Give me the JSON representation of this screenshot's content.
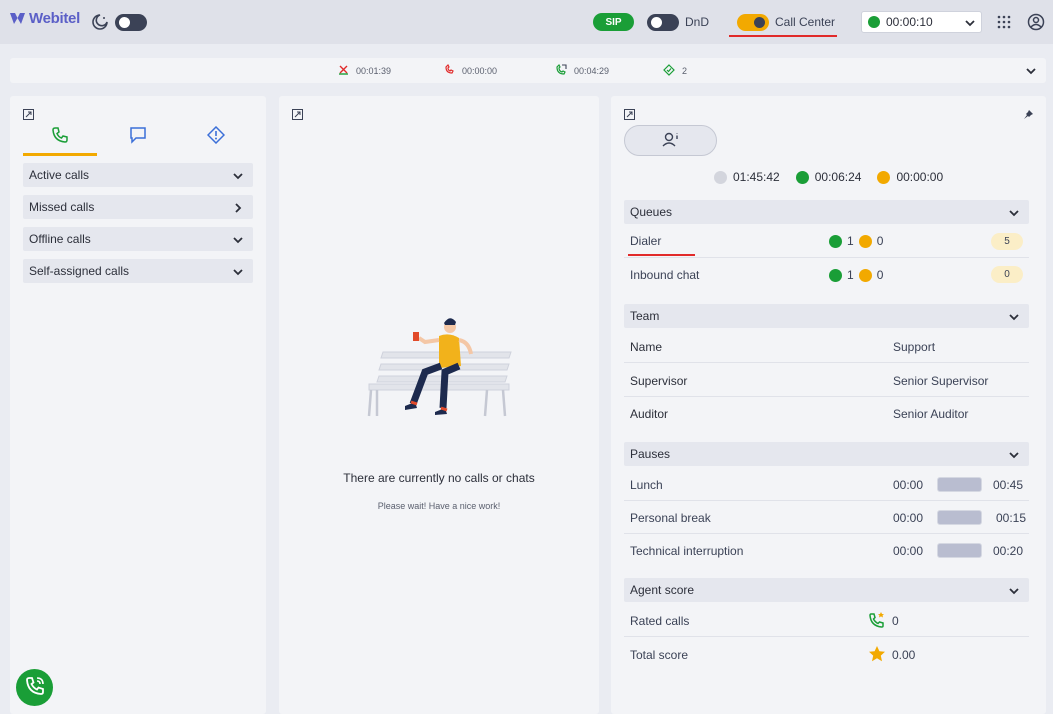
{
  "app": {
    "name": "Webitel"
  },
  "topbar": {
    "sip_label": "SIP",
    "dnd_label": "DnD",
    "call_center_label": "Call Center",
    "status_time": "00:00:10",
    "status_color": "#1a9e37",
    "accent": "#f2a900"
  },
  "stats": [
    {
      "icon": "missed-call-icon",
      "value": "00:01:39"
    },
    {
      "icon": "ended-call-icon",
      "value": "00:00:00"
    },
    {
      "icon": "transfer-call-icon",
      "value": "00:04:29"
    },
    {
      "icon": "diamond-check-icon",
      "value": "2"
    }
  ],
  "left": {
    "tabs": [
      {
        "icon": "phone-icon",
        "active": true
      },
      {
        "icon": "chat-icon",
        "active": false
      },
      {
        "icon": "alert-icon",
        "active": false
      }
    ],
    "sections": [
      {
        "label": "Active calls",
        "chevron": "down"
      },
      {
        "label": "Missed calls",
        "chevron": "right"
      },
      {
        "label": "Offline calls",
        "chevron": "down"
      },
      {
        "label": "Self-assigned calls",
        "chevron": "down"
      }
    ]
  },
  "middle": {
    "empty_title": "There are currently no calls or chats",
    "empty_subtitle": "Please wait! Have a nice work!"
  },
  "right": {
    "timers": [
      {
        "color": "#d3d5dd",
        "value": "01:45:42"
      },
      {
        "color": "#1a9e37",
        "value": "00:06:24"
      },
      {
        "color": "#f2a900",
        "value": "00:00:00"
      }
    ],
    "queues": {
      "title": "Queues",
      "items": [
        {
          "name": "Dialer",
          "green": "1",
          "yellow": "0",
          "count": "5"
        },
        {
          "name": "Inbound chat",
          "green": "1",
          "yellow": "0",
          "count": "0"
        }
      ]
    },
    "team": {
      "title": "Team",
      "rows": [
        {
          "label": "Name",
          "value": "Support"
        },
        {
          "label": "Supervisor",
          "value": "Senior Supervisor"
        },
        {
          "label": "Auditor",
          "value": "Senior Auditor"
        }
      ]
    },
    "pauses": {
      "title": "Pauses",
      "rows": [
        {
          "label": "Lunch",
          "start": "00:00",
          "end": "00:45"
        },
        {
          "label": "Personal break",
          "start": "00:00",
          "end": "00:15"
        },
        {
          "label": "Technical interruption",
          "start": "00:00",
          "end": "00:20"
        }
      ]
    },
    "agent_score": {
      "title": "Agent score",
      "rows": [
        {
          "label": "Rated calls",
          "value": "0"
        },
        {
          "label": "Total score",
          "value": "0.00"
        }
      ]
    }
  }
}
